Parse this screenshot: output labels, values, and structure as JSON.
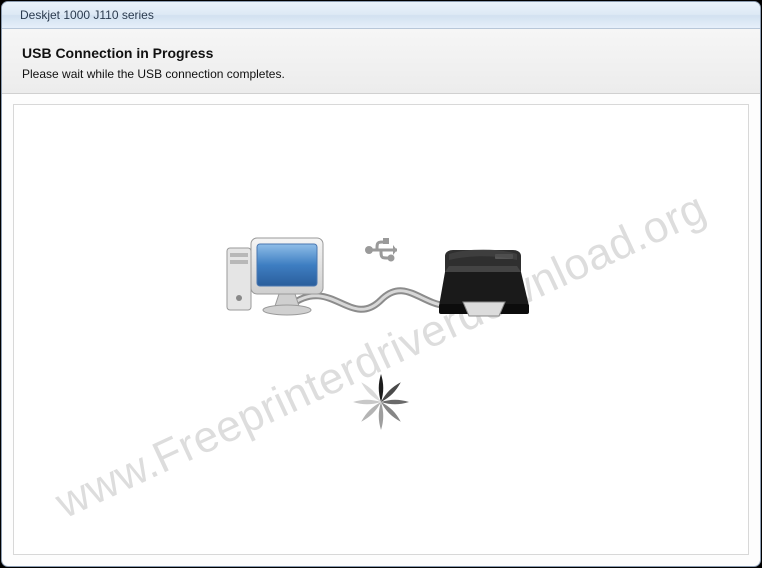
{
  "window": {
    "title": "Deskjet 1000 J110 series"
  },
  "header": {
    "title": "USB Connection in Progress",
    "subtitle": "Please wait while the USB connection completes."
  },
  "watermark": "www.Freeprinterdriverdownload.org",
  "icons": {
    "computer": "computer-monitor-icon",
    "usb": "usb-symbol-icon",
    "printer": "printer-icon",
    "cable": "usb-cable-icon",
    "spinner": "loading-spinner-icon"
  }
}
